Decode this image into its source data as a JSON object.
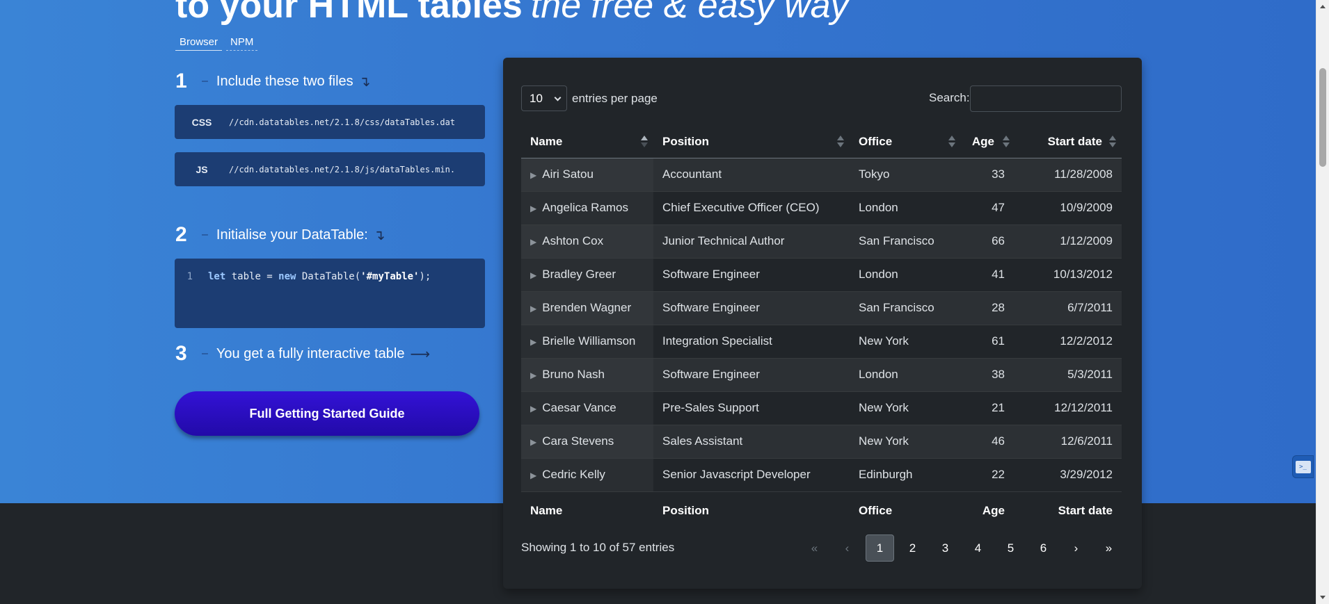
{
  "hero": {
    "headline_bold": "to your HTML tables",
    "headline_italic": "the free & easy way",
    "tabs": [
      "Browser",
      "NPM"
    ],
    "steps": [
      {
        "num": "1",
        "dash": "–",
        "text": "Include these two files",
        "arrow": "↴"
      },
      {
        "num": "2",
        "dash": "–",
        "text": "Initialise your DataTable:",
        "arrow": "↴"
      },
      {
        "num": "3",
        "dash": "–",
        "text": "You get a fully interactive table",
        "arrow": "⟶"
      }
    ],
    "files": [
      {
        "lang": "CSS",
        "path": "//cdn.datatables.net/2.1.8/css/dataTables.dat"
      },
      {
        "lang": "JS",
        "path": "//cdn.datatables.net/2.1.8/js/dataTables.min."
      }
    ],
    "init_code": {
      "line_no": "1",
      "kw1": "let",
      "part1": " table = ",
      "kw2": "new",
      "part2": " DataTable(",
      "str": "'#myTable'",
      "part3": ");"
    },
    "guide_button": "Full Getting Started Guide"
  },
  "table_panel": {
    "length": {
      "value": "10",
      "label": "entries per page"
    },
    "search": {
      "label": "Search:",
      "value": ""
    },
    "columns": [
      "Name",
      "Position",
      "Office",
      "Age",
      "Start date"
    ],
    "rows": [
      [
        "Airi Satou",
        "Accountant",
        "Tokyo",
        "33",
        "11/28/2008"
      ],
      [
        "Angelica Ramos",
        "Chief Executive Officer (CEO)",
        "London",
        "47",
        "10/9/2009"
      ],
      [
        "Ashton Cox",
        "Junior Technical Author",
        "San Francisco",
        "66",
        "1/12/2009"
      ],
      [
        "Bradley Greer",
        "Software Engineer",
        "London",
        "41",
        "10/13/2012"
      ],
      [
        "Brenden Wagner",
        "Software Engineer",
        "San Francisco",
        "28",
        "6/7/2011"
      ],
      [
        "Brielle Williamson",
        "Integration Specialist",
        "New York",
        "61",
        "12/2/2012"
      ],
      [
        "Bruno Nash",
        "Software Engineer",
        "London",
        "38",
        "5/3/2011"
      ],
      [
        "Caesar Vance",
        "Pre-Sales Support",
        "New York",
        "21",
        "12/12/2011"
      ],
      [
        "Cara Stevens",
        "Sales Assistant",
        "New York",
        "46",
        "12/6/2011"
      ],
      [
        "Cedric Kelly",
        "Senior Javascript Developer",
        "Edinburgh",
        "22",
        "3/29/2012"
      ]
    ],
    "expander_glyph": "▶",
    "info": "Showing 1 to 10 of 57 entries",
    "pager": {
      "first": "«",
      "prev": "‹",
      "pages": [
        "1",
        "2",
        "3",
        "4",
        "5",
        "6"
      ],
      "current": "1",
      "next": "›",
      "last": "»"
    }
  },
  "side_widget": {
    "icon": "terminal-icon",
    "glyph": ">_"
  },
  "colors": {
    "hero": "#3576cf",
    "button": "#2a0ec0",
    "panel": "#212529"
  }
}
